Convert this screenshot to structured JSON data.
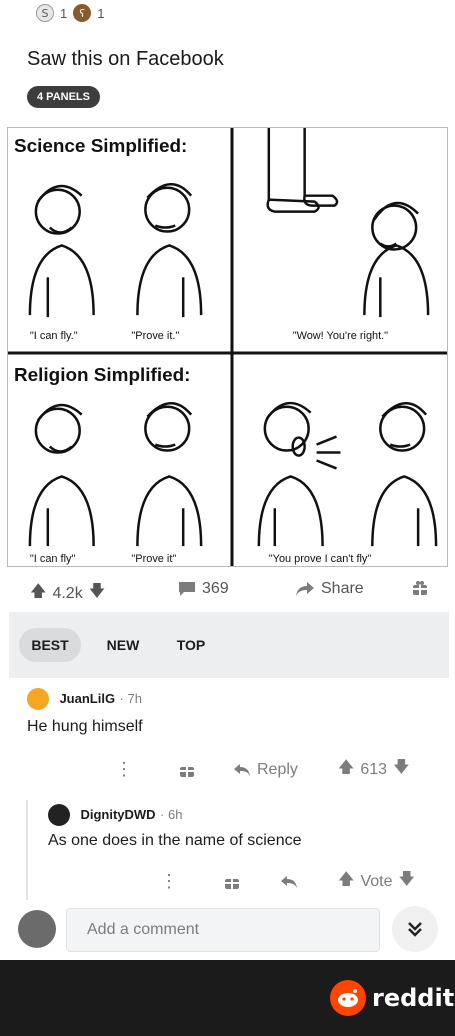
{
  "post": {
    "awards": [
      {
        "icon": "silver-award-icon",
        "count": "1"
      },
      {
        "icon": "bear-award-icon",
        "count": "1"
      }
    ],
    "title": "Saw this on Facebook",
    "flair": "4 PANELS",
    "comic": {
      "row1_heading": "Science Simplified:",
      "row2_heading": "Religion Simplified:",
      "captions": [
        "\"I can fly.\"",
        "\"Prove it.\"",
        "\"Wow! You're right.\"",
        "\"I can fly\"",
        "\"Prove it\"",
        "\"You prove I can't fly\""
      ]
    },
    "upvotes": "4.2k",
    "comments": "369",
    "share_label": "Share"
  },
  "sort": {
    "options": [
      "BEST",
      "NEW",
      "TOP"
    ],
    "active": "BEST"
  },
  "comments": [
    {
      "user": "JuanLilG",
      "time": "7h",
      "text": "He hung himself",
      "reply_label": "Reply",
      "score": "613"
    },
    {
      "user": "DignityDWD",
      "time": "6h",
      "text": "As one does in the name of science",
      "score": "Vote"
    }
  ],
  "composer": {
    "placeholder": "Add a comment"
  },
  "footer": {
    "brand": "reddit"
  },
  "colors": {
    "accent": "#ff4500",
    "flair_bg": "#3d3d3d",
    "footer_bg": "#1b1b1b"
  }
}
